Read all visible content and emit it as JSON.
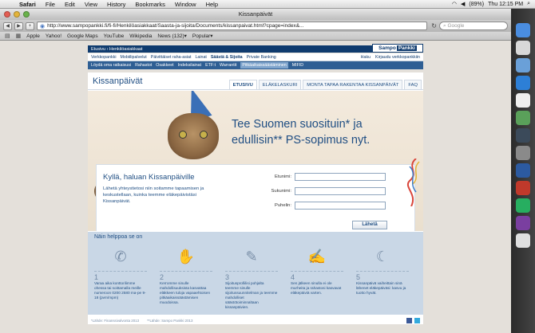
{
  "menubar": {
    "app": "Safari",
    "items": [
      "File",
      "Edit",
      "View",
      "History",
      "Bookmarks",
      "Window",
      "Help"
    ],
    "battery": "(89%)",
    "clock": "Thu 12:15 PM"
  },
  "window": {
    "title": "Kissanpäivät",
    "url": "http://www.sampopankki.fi/fi-fi/Henkilöasiakkaat/Saasta-ja-sijoita/Documents/kissanpaivat.html?cpage=index&...",
    "search_placeholder": "Google"
  },
  "bookmarks": [
    "Apple",
    "Yahoo!",
    "Google Maps",
    "YouTube",
    "Wikipedia",
    "News (132)▾",
    "Popular▾"
  ],
  "bank": {
    "crumb": "Etusivu › Henkilöasiakkaat",
    "logo_a": "Sampo",
    "logo_b": "Pankki",
    "nav1": [
      "Verkkopankki",
      "Mobiilipalvelut",
      "Päivittäiset raha-asiat",
      "Lainat",
      "Säästä & Sijoita",
      "Private Banking"
    ],
    "nav1_right": [
      "Haku",
      "Kirjaudu verkkopankkiin"
    ],
    "nav2": [
      "Löydä oma ratkaisusi",
      "Rahastot",
      "Osakkeet",
      "Indeksilainat",
      "ETF:t",
      "Warrantit",
      "Pitkäaikaissäästäminen",
      "MIFID"
    ],
    "nav2_active_index": 6
  },
  "site": {
    "title": "Kissanpäivät",
    "tabs": [
      "ETUSIVU",
      "ELÄKELASKURI",
      "MONTA TAPAA RAKENTAA KISSANPÄIVÄT",
      "FAQ"
    ],
    "headline": "Tee Suomen suosituin* ja edullisin** PS-sopimus nyt.",
    "form": {
      "title": "Kyllä, haluan Kissanpäiville",
      "text": "Lähetä yhteystietosi niin soitamme tapaamisen ja keskustellaan, kuinka teemme eläkepäivistäsi Kissanpäivät.",
      "fields": [
        "Etunimi:",
        "Sukunimi:",
        "Puhelin:"
      ],
      "submit": "Lähetä"
    },
    "steps_title": "Näin helppoa se on",
    "steps": [
      {
        "num": "1",
        "text": "Varaa aika konttorilimme ohessa tai soittamalla meille numeroon 0200 2580 ma-pe 9-18 (pvm/mpm)"
      },
      {
        "num": "2",
        "text": "Kerromme sinulle mahdollisuuksista kasvattaa eläkkeen tuloja vapaaehtoisen pitkäaikaissäästämisen muodoissa."
      },
      {
        "num": "3",
        "text": "Sijoitusprofiilisi pohjalta teemme sinulle sijoitussuunnitelman ja teemme mahdolliset säästötoiminnaltaan kissanpäivien."
      },
      {
        "num": "4",
        "text": "Sen jälkeen sinulla ei ole murheita ja rahastosi kasvavat eläkepäiviä varten."
      },
      {
        "num": "5",
        "text": "Kissanpäivä vaiheittain sinä lähenet eläkepäiväsi: kasvu ja tuotto hyvät."
      }
    ],
    "footer_a": "*Lähde: Finanssivalvonta 2013",
    "footer_b": "**Lähde: Sampo Pankki 2013"
  },
  "colors": {
    "brand": "#0f3b6e",
    "accent": "#1f4e83"
  }
}
